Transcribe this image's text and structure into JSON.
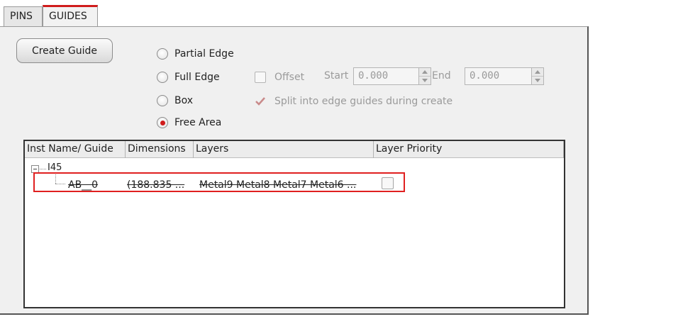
{
  "tabs": [
    {
      "label": "PINS",
      "active": false
    },
    {
      "label": "GUIDES",
      "active": true
    }
  ],
  "create_button_label": "Create Guide",
  "radio_options": [
    {
      "label": "Partial Edge",
      "checked": false
    },
    {
      "label": "Full Edge",
      "checked": false
    },
    {
      "label": "Box",
      "checked": false
    },
    {
      "label": "Free Area",
      "checked": true
    }
  ],
  "offset": {
    "label": "Offset",
    "checked": false,
    "enabled": false
  },
  "start": {
    "label": "Start",
    "value": "0.000"
  },
  "end": {
    "label": "End",
    "value": "0.000"
  },
  "split": {
    "label": "Split into edge guides during create",
    "checked": true,
    "enabled": false
  },
  "table": {
    "columns": [
      "Inst Name/ Guide",
      "Dimensions",
      "Layers",
      "Layer Priority"
    ],
    "parent": "I45",
    "child": {
      "name": "AB__0",
      "dimensions": "(188.835 ...",
      "layers": "Metal9 Metal8 Metal7 Metal6 ...",
      "layer_priority_checked": false
    }
  },
  "colors": {
    "accent": "#d01c1c",
    "highlight_border": "#e02020"
  }
}
